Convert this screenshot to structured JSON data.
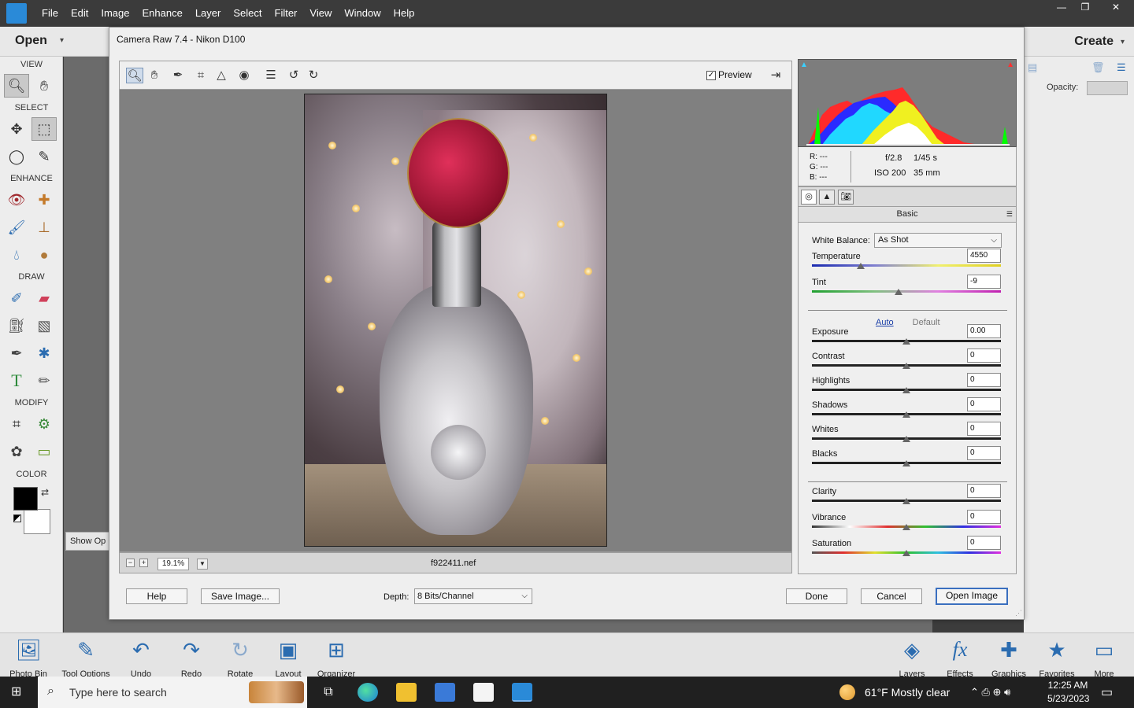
{
  "app": {
    "menu": [
      "File",
      "Edit",
      "Image",
      "Enhance",
      "Layer",
      "Select",
      "Filter",
      "View",
      "Window",
      "Help"
    ],
    "open_label": "Open",
    "create_label": "Create",
    "window_controls": [
      "—",
      "❐",
      "✕"
    ]
  },
  "toolbox": {
    "sections": [
      "VIEW",
      "SELECT",
      "ENHANCE",
      "DRAW",
      "MODIFY",
      "COLOR"
    ],
    "foreground_color": "#000000",
    "background_color": "#ffffff"
  },
  "behind": {
    "show_options_label": "Show Op",
    "opacity_label": "Opacity:"
  },
  "dialog": {
    "title": "Camera Raw 7.4  -  Nikon D100",
    "preview_label": "Preview",
    "preview_checked": true,
    "zoom": "19.1%",
    "filename": "f922411.nef",
    "rgb": {
      "r": "R:   ---",
      "g": "G:   ---",
      "b": "B:   ---"
    },
    "aperture": "f/2.8",
    "shutter": "1/45 s",
    "iso": "ISO 200",
    "focal": "35 mm",
    "panel_title": "Basic",
    "white_balance_label": "White Balance:",
    "white_balance_value": "As Shot",
    "auto_label": "Auto",
    "default_label": "Default",
    "sliders": [
      {
        "label": "Temperature",
        "value": "4550",
        "pos": 0.26
      },
      {
        "label": "Tint",
        "value": "-9",
        "pos": 0.46
      },
      {
        "label": "Exposure",
        "value": "0.00",
        "pos": 0.5
      },
      {
        "label": "Contrast",
        "value": "0",
        "pos": 0.5
      },
      {
        "label": "Highlights",
        "value": "0",
        "pos": 0.5
      },
      {
        "label": "Shadows",
        "value": "0",
        "pos": 0.5
      },
      {
        "label": "Whites",
        "value": "0",
        "pos": 0.5
      },
      {
        "label": "Blacks",
        "value": "0",
        "pos": 0.5
      },
      {
        "label": "Clarity",
        "value": "0",
        "pos": 0.5
      },
      {
        "label": "Vibrance",
        "value": "0",
        "pos": 0.5
      },
      {
        "label": "Saturation",
        "value": "0",
        "pos": 0.5
      }
    ],
    "buttons": {
      "help": "Help",
      "save": "Save Image...",
      "depth_label": "Depth:",
      "depth_value": "8 Bits/Channel",
      "done": "Done",
      "cancel": "Cancel",
      "open_image": "Open Image"
    }
  },
  "bottombar": {
    "left": [
      "Photo Bin",
      "Tool Options",
      "Undo",
      "Redo",
      "Rotate",
      "Layout",
      "Organizer"
    ],
    "right": [
      "Layers",
      "Effects",
      "Graphics",
      "Favorites",
      "More"
    ]
  },
  "taskbar": {
    "search_placeholder": "Type here to search",
    "weather": "61°F  Mostly clear",
    "time": "12:25 AM",
    "date": "5/23/2023"
  }
}
